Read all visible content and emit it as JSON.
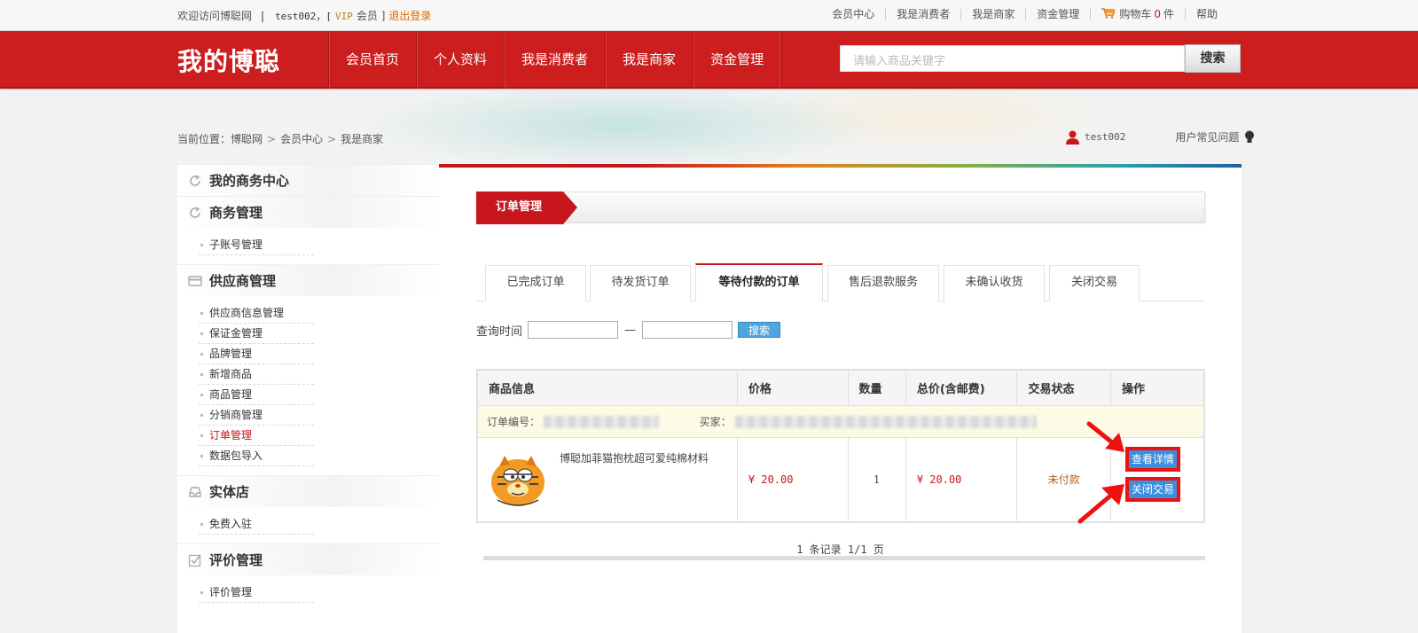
{
  "topbar": {
    "welcome": "欢迎访问博聪网",
    "separator": "|",
    "user": "test002，[",
    "vip": "VIP",
    "member": "会员 ]",
    "logout": "退出登录",
    "links": [
      "会员中心",
      "我是消费者",
      "我是商家",
      "资金管理"
    ],
    "cart_label": "购物车",
    "cart_count": "0",
    "cart_unit": "件",
    "help": "帮助"
  },
  "header": {
    "logo": "我的博聪",
    "nav": [
      "会员首页",
      "个人资料",
      "我是消费者",
      "我是商家",
      "资金管理"
    ],
    "search_placeholder": "请输入商品关键字",
    "search_button": "搜索"
  },
  "breadcrumb": {
    "label": "当前位置：",
    "items": [
      "博聪网",
      "会员中心",
      "我是商家"
    ],
    "sep": ">"
  },
  "user_info": {
    "username": "test002",
    "faq": "用户常见问题"
  },
  "sidebar": {
    "center_title": "我的商务中心",
    "groups": [
      {
        "title": "商务管理",
        "items": [
          "子账号管理"
        ]
      },
      {
        "title": "供应商管理",
        "items": [
          "供应商信息管理",
          "保证金管理",
          "品牌管理",
          "新增商品",
          "商品管理",
          "分销商管理",
          "订单管理",
          "数据包导入"
        ]
      },
      {
        "title": "实体店",
        "items": [
          "免费入驻"
        ]
      },
      {
        "title": "评价管理",
        "items": [
          "评价管理"
        ]
      }
    ],
    "active_item": "订单管理"
  },
  "main": {
    "title": "订单管理",
    "tabs": [
      "已完成订单",
      "待发货订单",
      "等待付款的订单",
      "售后退款服务",
      "未确认收货",
      "关闭交易"
    ],
    "active_tab": "等待付款的订单",
    "query_label": "查询时间",
    "query_dash": "—",
    "query_button": "搜索",
    "table": {
      "headers": [
        "商品信息",
        "价格",
        "数量",
        "总价(含邮费)",
        "交易状态",
        "操作"
      ],
      "order_no_label": "订单编号：",
      "buyer_label": "买家：",
      "goods_name": "博聪加菲猫抱枕超可爱纯棉材料",
      "price": "¥ 20.00",
      "qty": "1",
      "total": "¥ 20.00",
      "status": "未付款",
      "op_view": "查看详情",
      "op_close": "关闭交易"
    },
    "pager": "1 条记录 1/1 页"
  },
  "colors": {
    "brand_red": "#cc1e1e",
    "accent_blue": "#4da6dc",
    "highlight_red": "#ee1111"
  }
}
